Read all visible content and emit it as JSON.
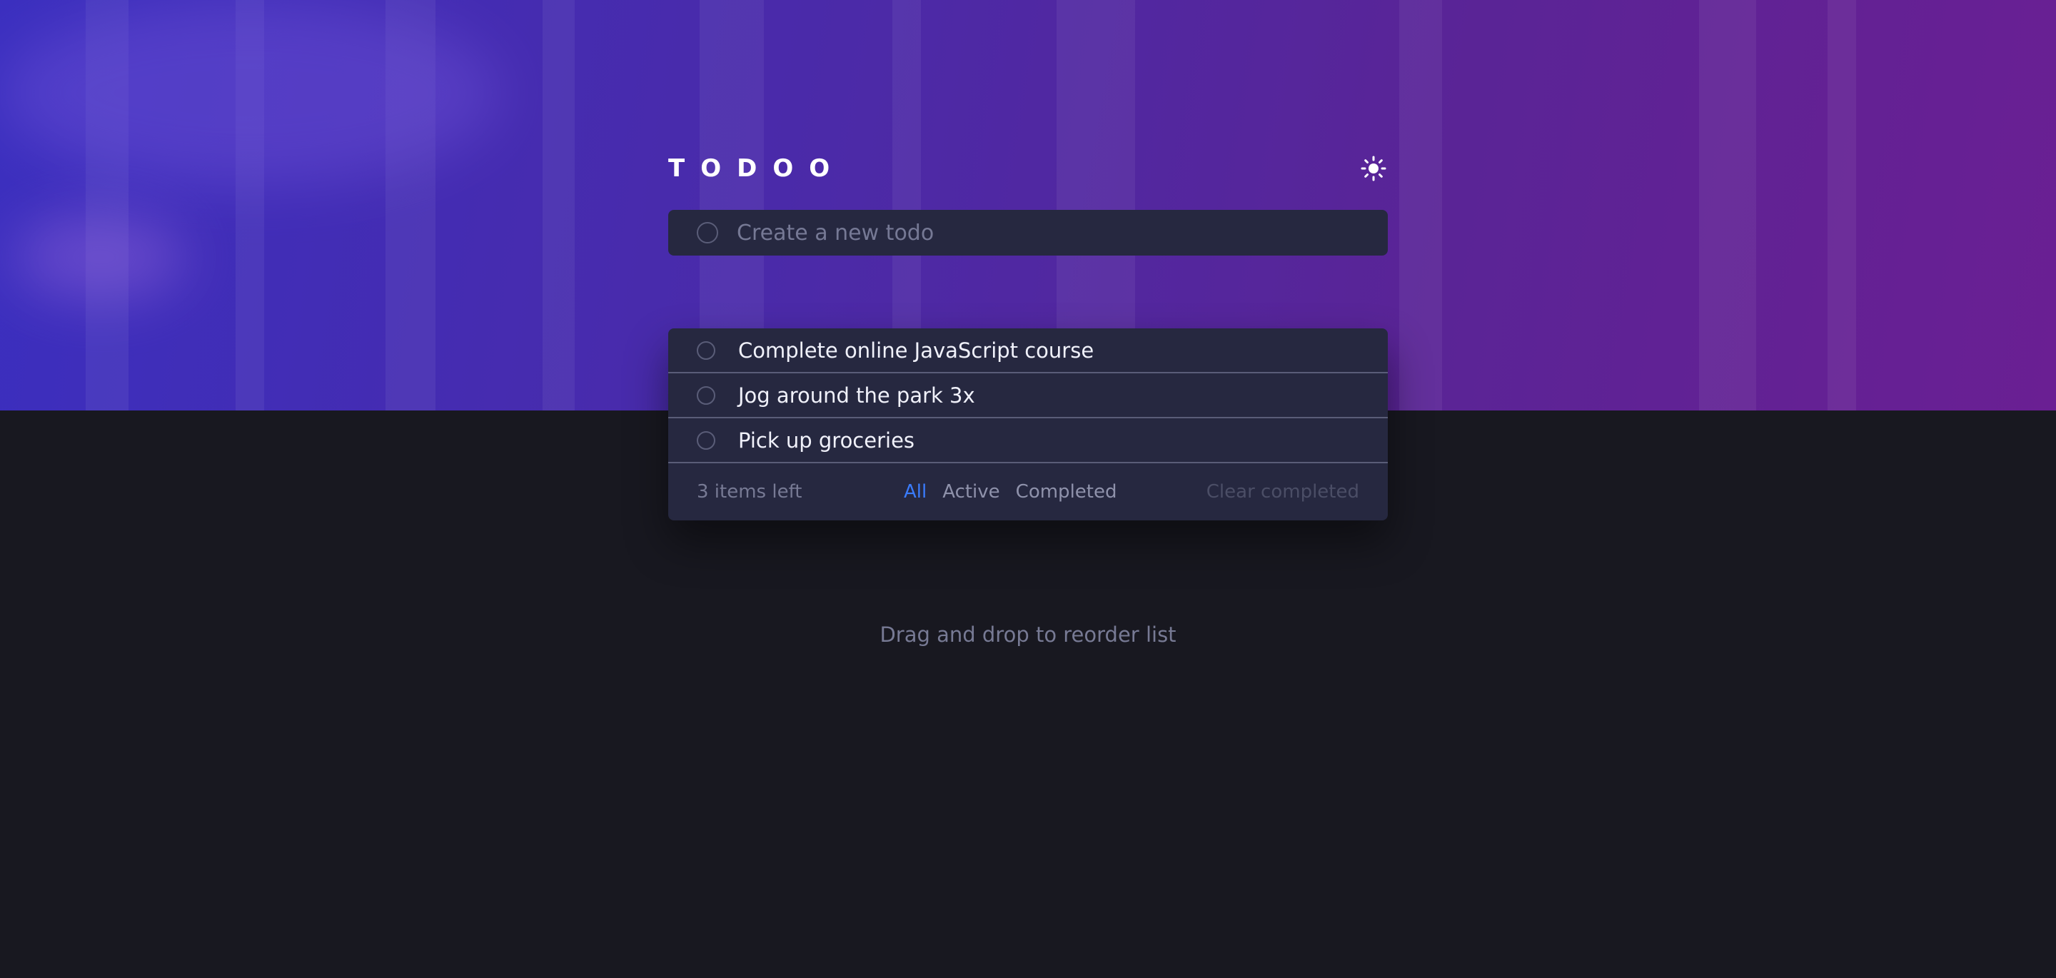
{
  "app": {
    "title": "TODOO",
    "theme_icon": "sun-icon"
  },
  "new_todo": {
    "placeholder": "Create a new todo",
    "value": ""
  },
  "todos": [
    {
      "text": "Complete online JavaScript course",
      "completed": false
    },
    {
      "text": "Jog around the park 3x",
      "completed": false
    },
    {
      "text": "Pick up groceries",
      "completed": false
    }
  ],
  "footer": {
    "items_left": "3 items left",
    "filters": [
      "All",
      "Active",
      "Completed"
    ],
    "active_filter": "All",
    "clear_label": "Clear completed"
  },
  "hint": "Drag and drop to reorder list",
  "colors": {
    "accent": "#3a7cfd",
    "card": "#262840",
    "background": "#181820"
  }
}
